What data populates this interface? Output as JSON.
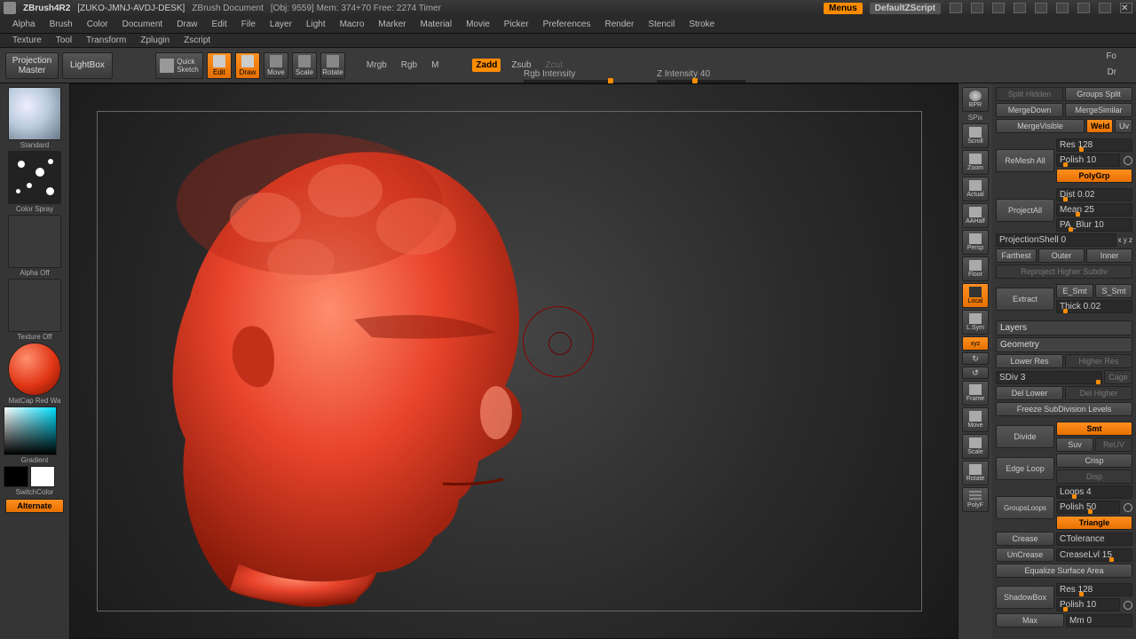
{
  "title": {
    "app": "ZBrush4R2",
    "machine": "[ZUKO-JMNJ-AVDJ-DESK]",
    "doc": "ZBrush Document",
    "stats": "[Obj: 9559]  Mem: 374+70  Free: 2274  Timer",
    "menus": "Menus",
    "defz": "DefaultZScript"
  },
  "menu1": [
    "Alpha",
    "Brush",
    "Color",
    "Document",
    "Draw",
    "Edit",
    "File",
    "Layer",
    "Light",
    "Macro",
    "Marker",
    "Material",
    "Movie",
    "Picker",
    "Preferences",
    "Render",
    "Stencil",
    "Stroke"
  ],
  "menu2": [
    "Texture",
    "Tool",
    "Transform",
    "Zplugin",
    "Zscript"
  ],
  "shelf": {
    "projMaster": "Projection\nMaster",
    "lightbox": "LightBox",
    "quickSketch": "Quick\nSketch",
    "modes": [
      "Edit",
      "Draw",
      "Move",
      "Scale",
      "Rotate"
    ],
    "blend": [
      "Mrgb",
      "Rgb",
      "M"
    ],
    "addmodes": [
      "Zadd",
      "Zsub",
      "Zcut"
    ],
    "rgbInt": "Rgb Intensity",
    "zInt": "Z Intensity 40",
    "fo": "Fo",
    "dr": "Dr"
  },
  "left": {
    "brush": "Standard",
    "stroke": "Color Spray",
    "alpha": "Alpha Off",
    "texture": "Texture Off",
    "material": "MatCap Red Wa",
    "gradient": "Gradient",
    "switch": "SwitchColor",
    "alt": "Alternate"
  },
  "rside": [
    "BPR",
    "SPix",
    "Scroll",
    "Zoom",
    "Actual",
    "AAHalf",
    "Persp",
    "Floor",
    "Local",
    "L.Sym",
    "xyz",
    "",
    "",
    "Frame",
    "Move",
    "Scale",
    "Rotate",
    "PolyF"
  ],
  "rp": {
    "row1": [
      "Split Hidden",
      "Groups Split"
    ],
    "row2": [
      "MergeDown",
      "MergeSimilar"
    ],
    "row3": [
      "MergeVisible",
      "Weld",
      "Uv"
    ],
    "remesh": "ReMesh All",
    "res128": "Res 128",
    "polish10": "Polish 10",
    "polygrp": "PolyGrp",
    "projectAll": "ProjectAll",
    "dist": "Dist 0.02",
    "mean": "Mean 25",
    "pablur": "PA_Blur 10",
    "projShell": "ProjectionShell 0",
    "xyz": "x y z",
    "farthest": "Farthest",
    "outer": "Outer",
    "inner": "Inner",
    "reproject": "Reproject Higher Subdiv",
    "extract": "Extract",
    "esmt": "E_Smt",
    "ssmt": "S_Smt",
    "thick": "Thick 0.02",
    "layers": "Layers",
    "geometry": "Geometry",
    "lowerRes": "Lower Res",
    "higherRes": "Higher Res",
    "sdiv": "SDiv 3",
    "cage": "Cage",
    "delLower": "Del Lower",
    "delHigher": "Del Higher",
    "freeze": "Freeze SubDivision Levels",
    "divide": "Divide",
    "smt": "Smt",
    "suv": "Suv",
    "reuv": "ReUV",
    "edgeloop": "Edge Loop",
    "crisp": "Crisp",
    "disp": "Disp",
    "groupsloops": "GroupsLoops",
    "loops": "Loops 4",
    "polish50": "Polish 50",
    "triangle": "Triangle",
    "crease": "Crease",
    "ctol": "CTolerance",
    "uncrease": "UnCrease",
    "creaselvl": "CreaseLvl 15",
    "equalize": "Equalize Surface Area",
    "shadowbox": "ShadowBox",
    "res128b": "Res 128",
    "polish10b": "Polish 10",
    "max": "Max",
    "mm": "Mm 0"
  }
}
